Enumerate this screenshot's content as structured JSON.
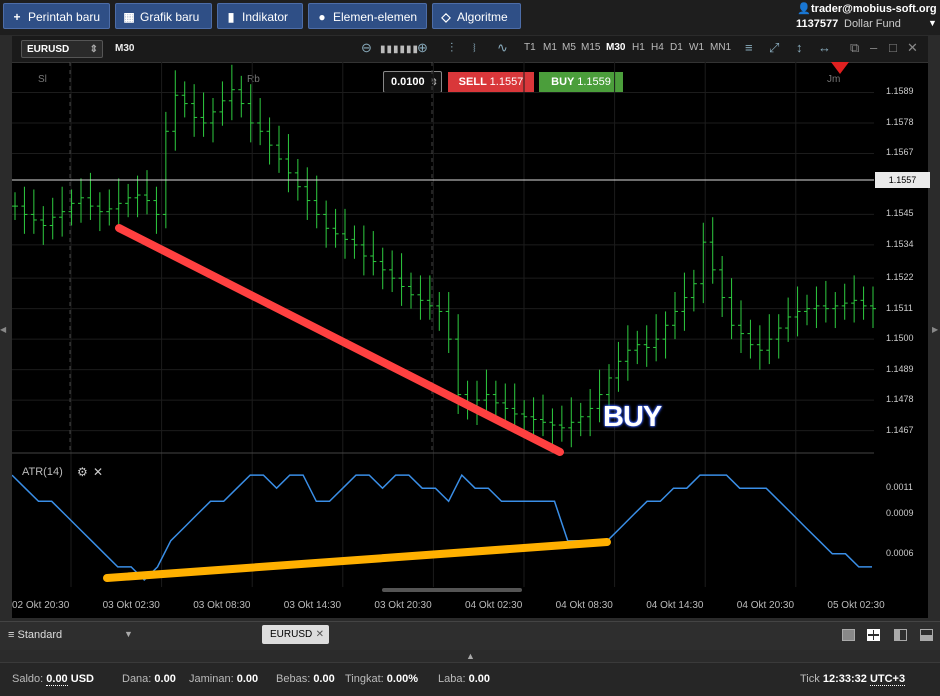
{
  "toolbar": {
    "new_order": "Perintah baru",
    "new_chart": "Grafik baru",
    "indicators": "Indikator",
    "elements": "Elemen-elemen",
    "algorithm": "Algoritme"
  },
  "account": {
    "email": "trader@mobius-soft.org",
    "id": "1137577",
    "fund": "Dollar Fund"
  },
  "chart": {
    "symbol": "EURUSD",
    "timeframe": "M30",
    "timeframes": [
      "T1",
      "M1",
      "M5",
      "M15",
      "M30",
      "H1",
      "H4",
      "D1",
      "W1",
      "MN1"
    ],
    "quantity": "0.0100",
    "sell_label": "SELL",
    "sell_price": "1.1557",
    "buy_label": "BUY",
    "buy_price": "1.1559",
    "session_labels": [
      "Sl",
      "Rb",
      "Jm"
    ],
    "current_price": "1.1557",
    "annotation": "BUY",
    "indicator_name": "ATR(14)",
    "colors": {
      "bull": "#2ecc40",
      "atr": "#3a8ee6",
      "trend_down": "#ff4040",
      "trend_up": "#ffb000"
    }
  },
  "chart_data": [
    {
      "type": "bar",
      "title": "EURUSD M30",
      "y_ticks": [
        "1.1589",
        "1.1578",
        "1.1567",
        "1.1545",
        "1.1534",
        "1.1522",
        "1.1511",
        "1.1500",
        "1.1489",
        "1.1478",
        "1.1467"
      ],
      "x_ticks": [
        "02 Okt 20:30",
        "03 Okt 02:30",
        "03 Okt 08:30",
        "03 Okt 14:30",
        "03 Okt 20:30",
        "04 Okt 02:30",
        "04 Okt 08:30",
        "04 Okt 14:30",
        "04 Okt 20:30",
        "05 Okt 02:30"
      ],
      "ylim": [
        1.146,
        1.16
      ],
      "close": [
        1.1548,
        1.1545,
        1.1543,
        1.1541,
        1.1544,
        1.1546,
        1.1549,
        1.1551,
        1.1548,
        1.1546,
        1.1547,
        1.1549,
        1.1551,
        1.1552,
        1.155,
        1.1545,
        1.1575,
        1.1588,
        1.1585,
        1.158,
        1.1578,
        1.1582,
        1.1586,
        1.159,
        1.1585,
        1.1578,
        1.1575,
        1.157,
        1.1565,
        1.156,
        1.1555,
        1.155,
        1.1545,
        1.154,
        1.1538,
        1.1536,
        1.1534,
        1.153,
        1.1528,
        1.1525,
        1.1522,
        1.1519,
        1.1516,
        1.1514,
        1.1512,
        1.151,
        1.15,
        1.148,
        1.1476,
        1.1478,
        1.148,
        1.1477,
        1.1475,
        1.1473,
        1.1472,
        1.1471,
        1.147,
        1.1469,
        1.1468,
        1.147,
        1.1472,
        1.1475,
        1.148,
        1.1486,
        1.1492,
        1.1496,
        1.1498,
        1.1497,
        1.15,
        1.1505,
        1.151,
        1.1515,
        1.152,
        1.1535,
        1.1525,
        1.1515,
        1.1505,
        1.1502,
        1.1498,
        1.1496,
        1.15,
        1.1504,
        1.1508,
        1.151,
        1.1511,
        1.1512,
        1.1511,
        1.1512,
        1.1513,
        1.1514,
        1.1512,
        1.1511
      ]
    },
    {
      "type": "line",
      "title": "ATR(14)",
      "y_ticks": [
        "0.0011",
        "0.0009",
        "0.0006"
      ],
      "ylim": [
        0.0004,
        0.0013
      ],
      "values": [
        0.0012,
        0.0011,
        0.001,
        0.001,
        0.0009,
        0.0008,
        0.0007,
        0.0006,
        0.0005,
        0.0005,
        0.0004,
        0.0005,
        0.0007,
        0.0008,
        0.0009,
        0.001,
        0.001,
        0.0011,
        0.0012,
        0.0012,
        0.0011,
        0.0012,
        0.0012,
        0.001,
        0.001,
        0.0011,
        0.0012,
        0.0012,
        0.0011,
        0.0012,
        0.0012,
        0.0011,
        0.0011,
        0.001,
        0.0012,
        0.0011,
        0.0011,
        0.001,
        0.001,
        0.001,
        0.001,
        0.001,
        0.0007,
        0.0007,
        0.0007,
        0.0007,
        0.0008,
        0.0009,
        0.001,
        0.001,
        0.0011,
        0.0011,
        0.0012,
        0.0012,
        0.0012,
        0.0011,
        0.0011,
        0.0011,
        0.001,
        0.0009,
        0.0008,
        0.0007,
        0.0006,
        0.0006,
        0.0005,
        0.0005
      ]
    }
  ],
  "bottom": {
    "profile": "Standard",
    "tab": "EURUSD",
    "saldo_label": "Saldo:",
    "saldo": "0.00",
    "saldo_unit": "USD",
    "dana_label": "Dana:",
    "dana": "0.00",
    "jaminan_label": "Jaminan:",
    "jaminan": "0.00",
    "bebas_label": "Bebas:",
    "bebas": "0.00",
    "tingkat_label": "Tingkat:",
    "tingkat": "0.00%",
    "laba_label": "Laba:",
    "laba": "0.00",
    "tick_label": "Tick",
    "time": "12:33:32",
    "timezone": "UTC+3"
  }
}
